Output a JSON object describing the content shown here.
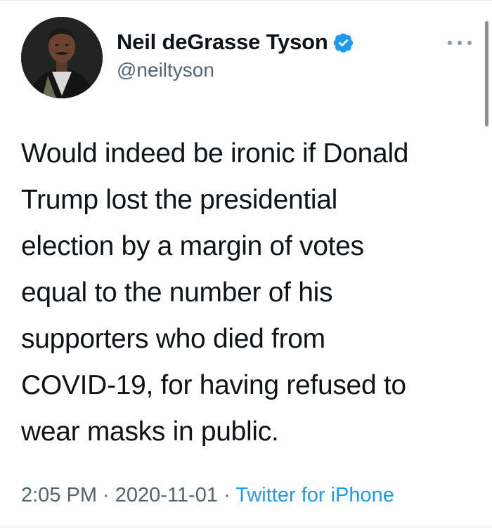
{
  "author": {
    "display_name": "Neil deGrasse Tyson",
    "handle": "@neiltyson",
    "verified": true,
    "avatar": "avatar-photo"
  },
  "tweet": {
    "text": "Would indeed be ironic if Donald\nTrump lost the presidential\nelection by a margin of votes\nequal to the number of his\nsupporters who died from\nCOVID-19, for having refused to\nwear masks in public.",
    "time": "2:05 PM",
    "separator": " · ",
    "date": "2020-11-01",
    "source": "Twitter for iPhone"
  },
  "icons": {
    "verified": "verified-badge-icon",
    "more": "more-options-icon"
  },
  "colors": {
    "text": "#0f1419",
    "secondary": "#536471",
    "link": "#1d9bf0",
    "verified": "#1d9bf0"
  }
}
